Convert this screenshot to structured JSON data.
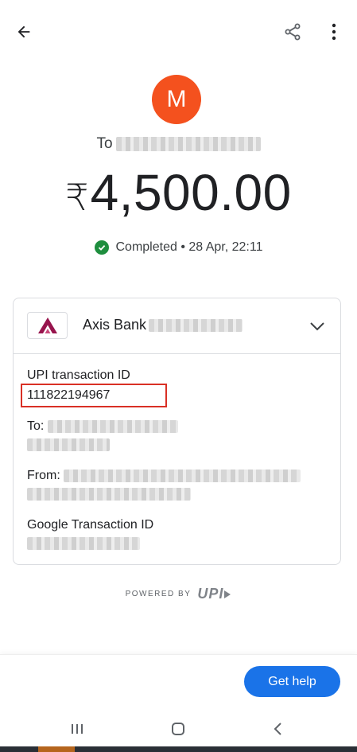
{
  "header": {
    "back_icon": "arrow-left-icon",
    "share_icon": "share-icon",
    "more_icon": "more-vert-icon"
  },
  "recipient": {
    "avatar_initial": "M",
    "avatar_color": "#f4511e",
    "to_prefix": "To"
  },
  "payment": {
    "currency_symbol": "₹",
    "amount": "4,500.00",
    "status_text": "Completed • 28 Apr, 22:11",
    "status_color": "#1e8e3e"
  },
  "details_card": {
    "bank_name": "Axis Bank",
    "bank_logo_color": "#97144d",
    "upi_label": "UPI transaction ID",
    "upi_value": "111822194967",
    "to_label": "To:",
    "from_label": "From:",
    "google_txn_label": "Google Transaction ID",
    "highlight_color": "#d93025"
  },
  "footer": {
    "powered_by": "POWERED BY",
    "upi_logo_text": "UPI",
    "help_button": "Get help",
    "accent": "#1a73e8"
  },
  "system_nav": {
    "recents_icon": "recents-icon",
    "home_icon": "home-icon",
    "back_icon": "nav-back-icon"
  }
}
